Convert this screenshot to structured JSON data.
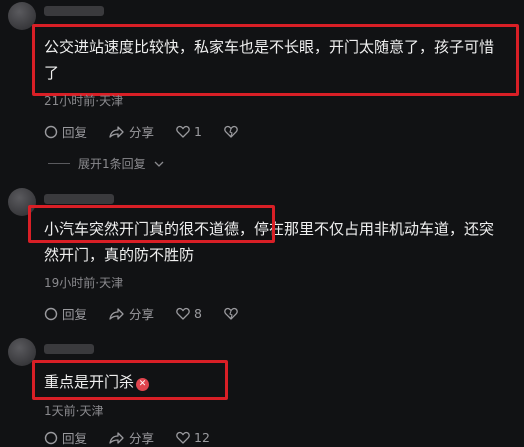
{
  "comments": [
    {
      "text": "公交进站速度比较快，私家车也是不长眼，开门太随意了，孩子可惜了",
      "meta": "21小时前·天津",
      "reply_label": "回复",
      "share_label": "分享",
      "like_count": "1",
      "expand_label": "展开1条回复"
    },
    {
      "text": "小汽车突然开门真的很不道德，停在那里不仅占用非机动车道，还突然开门，真的防不胜防",
      "meta": "19小时前·天津",
      "reply_label": "回复",
      "share_label": "分享",
      "like_count": "8"
    },
    {
      "text": "重点是开门杀",
      "meta": "1天前·天津",
      "reply_label": "回复",
      "share_label": "分享",
      "like_count": "12"
    }
  ],
  "colors": {
    "highlight": "#d91f26",
    "background": "#111214"
  }
}
